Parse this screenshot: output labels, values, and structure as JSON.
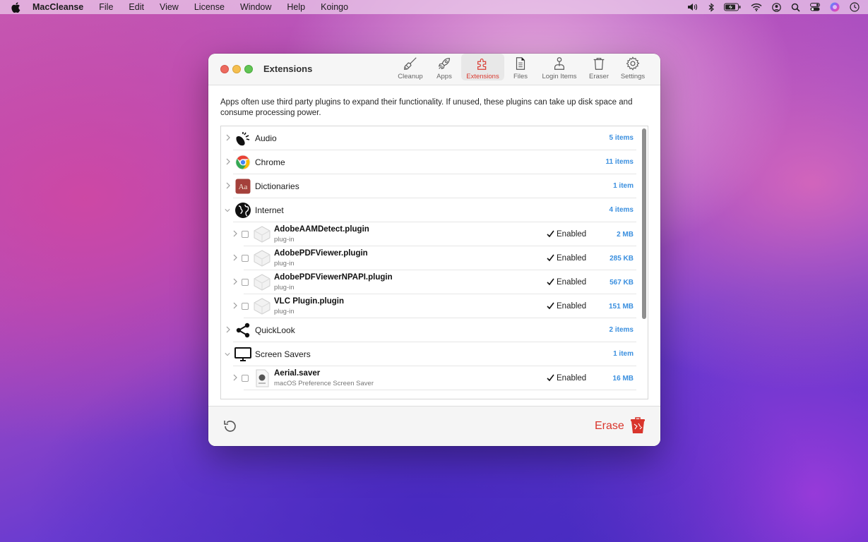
{
  "menubar": {
    "app_name": "MacCleanse",
    "items": [
      "File",
      "Edit",
      "View",
      "License",
      "Window",
      "Help",
      "Koingo"
    ],
    "status_icons": [
      "volume-icon",
      "bluetooth-icon",
      "battery-icon",
      "wifi-icon",
      "user-icon",
      "spotlight-icon",
      "control-center-icon",
      "siri-icon",
      "clock-icon"
    ]
  },
  "window": {
    "title": "Extensions",
    "toolbar": [
      {
        "label": "Cleanup",
        "icon": "broom-icon"
      },
      {
        "label": "Apps",
        "icon": "rocket-icon"
      },
      {
        "label": "Extensions",
        "icon": "puzzle-icon",
        "active": true
      },
      {
        "label": "Files",
        "icon": "document-icon"
      },
      {
        "label": "Login Items",
        "icon": "login-items-icon"
      },
      {
        "label": "Eraser",
        "icon": "trash-icon"
      },
      {
        "label": "Settings",
        "icon": "gear-icon"
      }
    ],
    "accent_color": "#d93a30",
    "count_color": "#3a8fdf",
    "description": "Apps often use third party plugins to expand their functionality. If unused, these plugins can take up disk space and consume processing power.",
    "categories": [
      {
        "name": "Audio",
        "count": "5 items",
        "expanded": false,
        "icon": "audio-icon"
      },
      {
        "name": "Chrome",
        "count": "11 items",
        "expanded": false,
        "icon": "chrome-icon"
      },
      {
        "name": "Dictionaries",
        "count": "1 item",
        "expanded": false,
        "icon": "dictionary-icon"
      },
      {
        "name": "Internet",
        "count": "4 items",
        "expanded": true,
        "icon": "globe-icon",
        "items": [
          {
            "name": "AdobeAAMDetect.plugin",
            "type": "plug-in",
            "enabled_label": "Enabled",
            "size": "2 MB"
          },
          {
            "name": "AdobePDFViewer.plugin",
            "type": "plug-in",
            "enabled_label": "Enabled",
            "size": "285 KB"
          },
          {
            "name": "AdobePDFViewerNPAPI.plugin",
            "type": "plug-in",
            "enabled_label": "Enabled",
            "size": "567 KB"
          },
          {
            "name": "VLC Plugin.plugin",
            "type": "plug-in",
            "enabled_label": "Enabled",
            "size": "151 MB"
          }
        ]
      },
      {
        "name": "QuickLook",
        "count": "2 items",
        "expanded": false,
        "icon": "share-icon"
      },
      {
        "name": "Screen Savers",
        "count": "1 item",
        "expanded": true,
        "icon": "monitor-icon",
        "items": [
          {
            "name": "Aerial.saver",
            "type": "macOS Preference Screen Saver",
            "enabled_label": "Enabled",
            "size": "16 MB"
          }
        ]
      }
    ],
    "footer": {
      "erase_label": "Erase"
    }
  }
}
